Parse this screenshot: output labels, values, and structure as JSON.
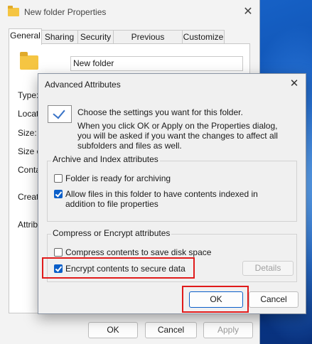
{
  "properties_window": {
    "title": "New folder Properties",
    "close_glyph": "✕",
    "tabs": [
      "General",
      "Sharing",
      "Security",
      "Previous Versions",
      "Customize"
    ],
    "active_tab": "General",
    "name_value": "New folder",
    "labels": [
      "Type:",
      "Locati",
      "Size:",
      "Size o",
      "Contai",
      "Create",
      "Attribu"
    ],
    "buttons": {
      "ok": "OK",
      "cancel": "Cancel",
      "apply": "Apply"
    }
  },
  "dialog": {
    "title": "Advanced Attributes",
    "close_glyph": "✕",
    "heading": "Choose the settings you want for this folder.",
    "description": "When you click OK or Apply on the Properties dialog, you will be asked if you want the changes to affect all subfolders and files as well.",
    "archive_group": {
      "label": "Archive and Index attributes",
      "options": [
        {
          "label": "Folder is ready for archiving",
          "checked": false
        },
        {
          "label": "Allow files in this folder to have contents indexed in addition to file properties",
          "checked": true
        }
      ]
    },
    "compress_group": {
      "label": "Compress or Encrypt attributes",
      "options": [
        {
          "label": "Compress contents to save disk space",
          "checked": false
        },
        {
          "label": "Encrypt contents to secure data",
          "checked": true
        }
      ]
    },
    "details_button": "Details",
    "ok_button": "OK",
    "cancel_button": "Cancel"
  },
  "colors": {
    "accent": "#0b5fc9",
    "highlight": "#e01b1b"
  },
  "icons": [
    "folder-icon",
    "close-icon",
    "checkmark-info-icon",
    "checkbox-icon"
  ]
}
